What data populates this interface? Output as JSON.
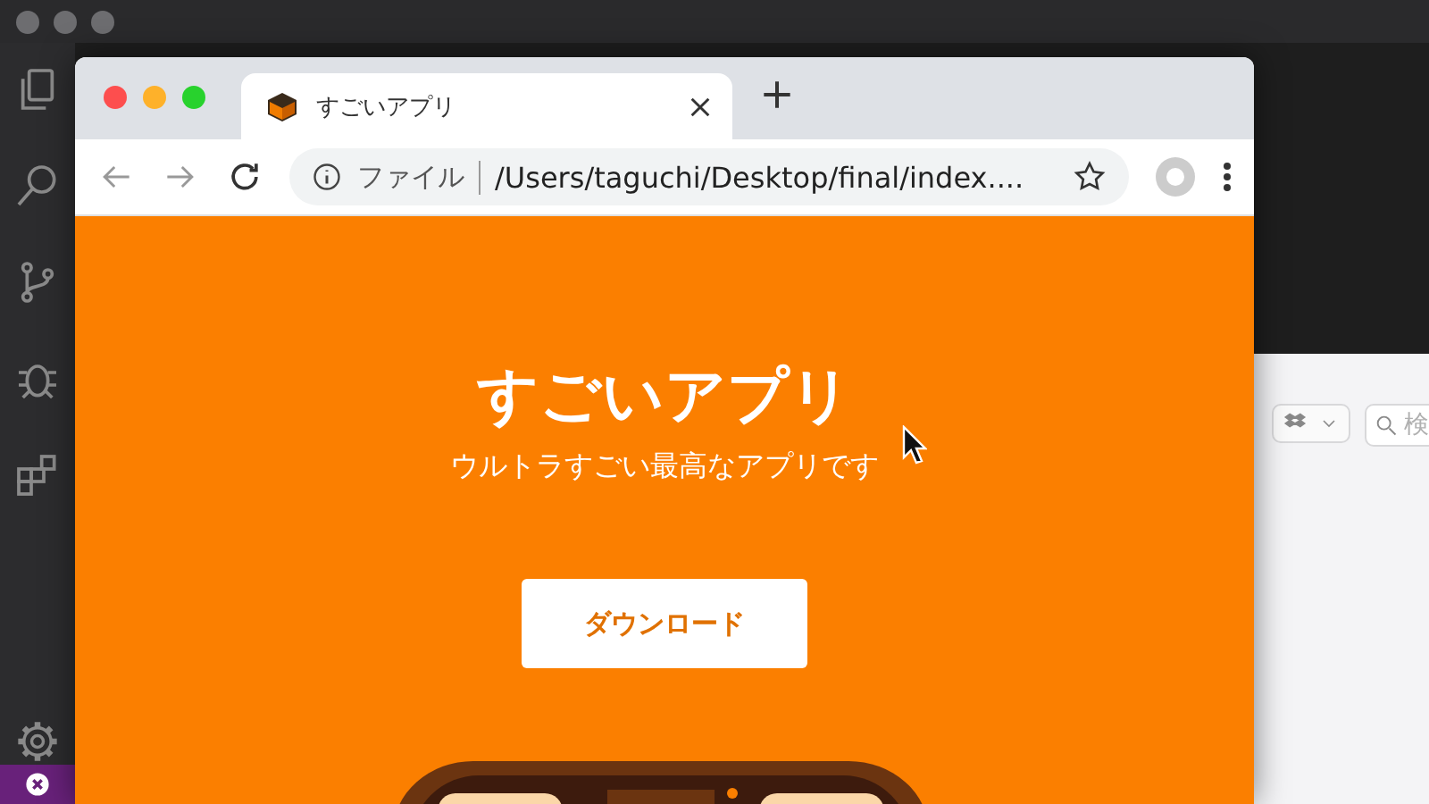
{
  "browser": {
    "tab": {
      "title": "すごいアプリ",
      "selected": true
    },
    "address": {
      "scheme": "ファイル",
      "url": "/Users/taguchi/Desktop/final/index...."
    }
  },
  "page": {
    "title": "すごいアプリ",
    "subtitle": "ウルトラすごい最高なアプリです",
    "button": "ダウンロード"
  },
  "back_window": {
    "search": {
      "placeholder": "検"
    }
  }
}
